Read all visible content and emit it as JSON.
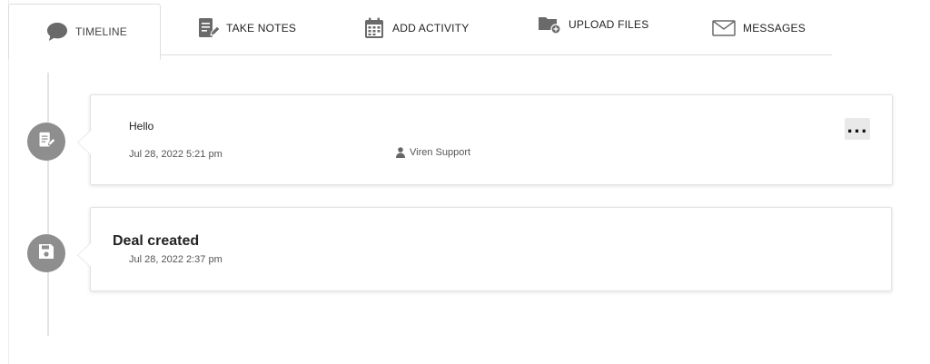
{
  "tabs": [
    {
      "label": "TIMELINE",
      "icon": "comment-icon",
      "active": true
    },
    {
      "label": "TAKE NOTES",
      "icon": "note-edit-icon",
      "active": false
    },
    {
      "label": "ADD ACTIVITY",
      "icon": "calendar-icon",
      "active": false
    },
    {
      "label": "UPLOAD FILES",
      "icon": "folder-add-icon",
      "active": false
    },
    {
      "label": "MESSAGES",
      "icon": "envelope-icon",
      "active": false
    }
  ],
  "timeline": [
    {
      "type": "note",
      "icon": "note-edit-icon",
      "text": "Hello",
      "date": "Jul 28, 2022 5:21 pm",
      "author": "Viren Support",
      "more_label": "..."
    },
    {
      "type": "deal",
      "icon": "save-icon",
      "title": "Deal created",
      "date": "Jul 28, 2022 2:37 pm"
    }
  ],
  "colors": {
    "node": "#8e8e8e",
    "icon": "#666666",
    "border": "#dddddd"
  }
}
